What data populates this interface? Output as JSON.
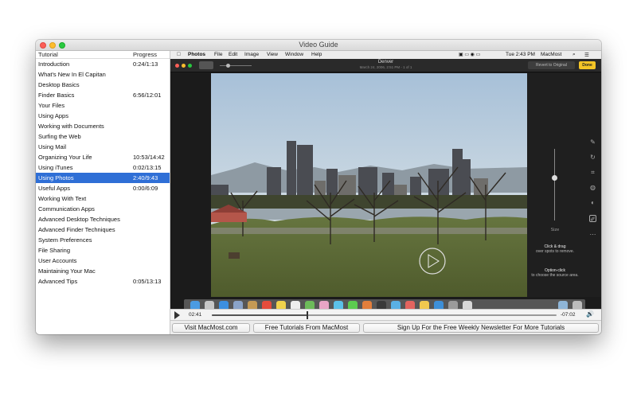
{
  "window": {
    "title": "Video Guide"
  },
  "sidebar": {
    "col_tutorial": "Tutorial",
    "col_progress": "Progress",
    "items": [
      {
        "label": "Introduction",
        "progress": "0:24/1:13"
      },
      {
        "label": "What's New In El Capitan",
        "progress": ""
      },
      {
        "label": "Desktop Basics",
        "progress": ""
      },
      {
        "label": "Finder Basics",
        "progress": "6:56/12:01"
      },
      {
        "label": "Your Files",
        "progress": ""
      },
      {
        "label": "Using Apps",
        "progress": ""
      },
      {
        "label": "Working with Documents",
        "progress": ""
      },
      {
        "label": "Surfing the Web",
        "progress": ""
      },
      {
        "label": "Using Mail",
        "progress": ""
      },
      {
        "label": "Organizing Your Life",
        "progress": "10:53/14:42"
      },
      {
        "label": "Using iTunes",
        "progress": "0:02/13:15"
      },
      {
        "label": "Using Photos",
        "progress": "2:40/9:43",
        "selected": true
      },
      {
        "label": "Useful Apps",
        "progress": "0:00/6:09"
      },
      {
        "label": "Working With Text",
        "progress": ""
      },
      {
        "label": "Communication Apps",
        "progress": ""
      },
      {
        "label": "Advanced Desktop Techniques",
        "progress": ""
      },
      {
        "label": "Advanced Finder Techniques",
        "progress": ""
      },
      {
        "label": "System Preferences",
        "progress": ""
      },
      {
        "label": "File Sharing",
        "progress": ""
      },
      {
        "label": "User Accounts",
        "progress": ""
      },
      {
        "label": "Maintaining Your Mac",
        "progress": ""
      },
      {
        "label": "Advanced Tips",
        "progress": "0:05/13:13"
      }
    ]
  },
  "video": {
    "menubar": {
      "apple": "",
      "items": [
        "Photos",
        "File",
        "Edit",
        "Image",
        "View",
        "Window",
        "Help"
      ],
      "clock": "Tue 2:43 PM",
      "user": "MacMost"
    },
    "photos": {
      "title": "Denver",
      "subtitle": "March 24, 2006, 2:51 PM  -  1 of 1",
      "revert_label": "Revert to Original",
      "done_label": "Done",
      "size_label": "Size",
      "hint1_title": "Click & drag",
      "hint1_body": "over spots to remove.",
      "hint2_title": "Option-click",
      "hint2_body": "to choose the source area."
    },
    "controls": {
      "current_time": "02:41",
      "remaining_time": "-07:02",
      "progress": 0.276
    }
  },
  "bottom_bar": {
    "visit_label": "Visit MacMost.com",
    "tutorials_label": "Free Tutorials From MacMost",
    "newsletter_label": "Sign Up For the Free Weekly Newsletter For More Tutorials"
  },
  "colors": {
    "selection": "#2f6fd6",
    "done_button": "#f4c526"
  }
}
